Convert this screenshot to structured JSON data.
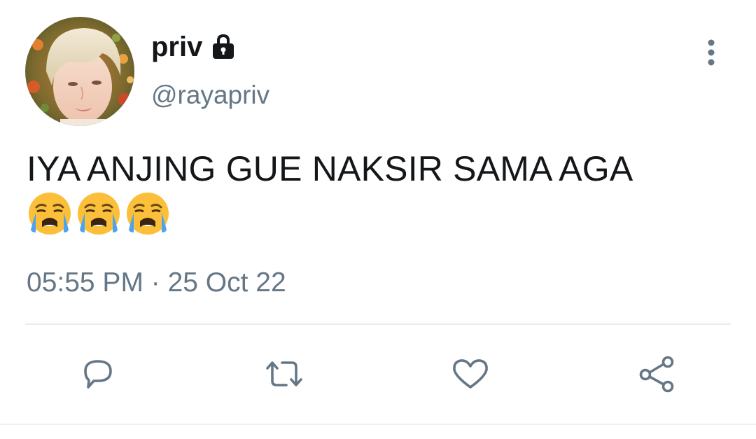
{
  "author": {
    "display_name": "priv",
    "handle": "@rayapriv",
    "protected": true,
    "lock_icon": "lock-icon"
  },
  "tweet": {
    "text": "IYA ANJING GUE NAKSIR SAMA AGA",
    "emojis": [
      "loudly-crying-face",
      "loudly-crying-face",
      "loudly-crying-face"
    ],
    "emoji_chars": [
      "😭",
      "😭",
      "😭"
    ],
    "timestamp": "05:55 PM · 25 Oct 22"
  },
  "actions": [
    {
      "name": "reply",
      "icon": "reply-icon"
    },
    {
      "name": "retweet",
      "icon": "retweet-icon"
    },
    {
      "name": "like",
      "icon": "heart-icon"
    },
    {
      "name": "share",
      "icon": "share-icon"
    }
  ],
  "colors": {
    "text_primary": "#14171a",
    "text_secondary": "#657786",
    "divider": "#e6ecf0"
  }
}
